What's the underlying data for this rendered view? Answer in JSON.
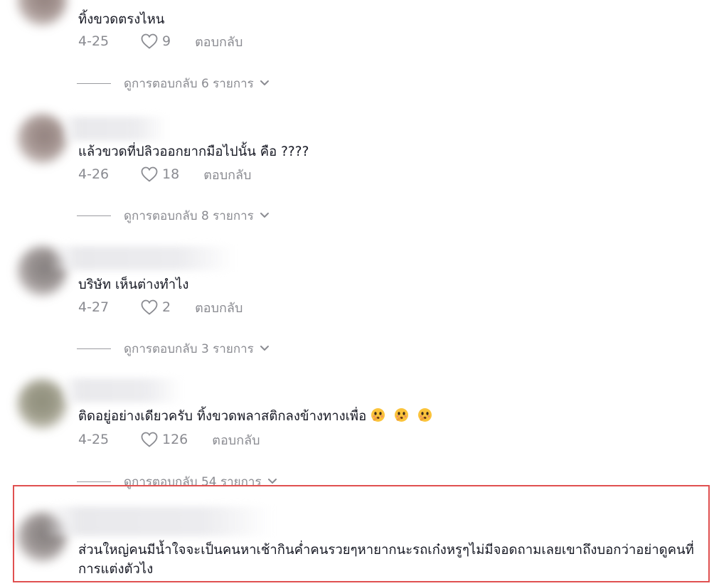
{
  "comments": [
    {
      "text": "ทิ้งขวดตรงไหน",
      "date": "4-25",
      "likes": "9",
      "reply_label": "ตอบกลับ",
      "view_replies": "ดูการตอบกลับ 6 รายการ"
    },
    {
      "text": "แล้วขวดที่ปลิวออกยากมือไปนั้น คือ ????",
      "date": "4-26",
      "likes": "18",
      "reply_label": "ตอบกลับ",
      "view_replies": "ดูการตอบกลับ 8 รายการ"
    },
    {
      "text": "บริษัท เห็นต่างทำไง",
      "date": "4-27",
      "likes": "2",
      "reply_label": "ตอบกลับ",
      "view_replies": "ดูการตอบกลับ 3 รายการ"
    },
    {
      "text": "ติดอยู่อย่างเดียวครับ ทิ้งขวดพลาสติกลงข้างทางเพื่อ",
      "emojis": [
        "thinking-flushed-face-icon",
        "thinking-flushed-face-icon",
        "thinking-flushed-face-icon"
      ],
      "date": "4-25",
      "likes": "126",
      "reply_label": "ตอบกลับ",
      "view_replies": "ดูการตอบกลับ 54 รายการ"
    },
    {
      "text": "ส่วนใหญ่คนมีน้ำใจจะเป็นคนหาเช้ากินค่ำคนรวยๆหายากนะรถเก๋งหรูๆไม่มีจอดถามเลยเขาถึงบอกว่าอย่าดูคนที่การแต่งตัวไง"
    }
  ],
  "colors": {
    "text": "#161823",
    "muted": "#8a8b91",
    "highlight_border": "#e05050"
  }
}
